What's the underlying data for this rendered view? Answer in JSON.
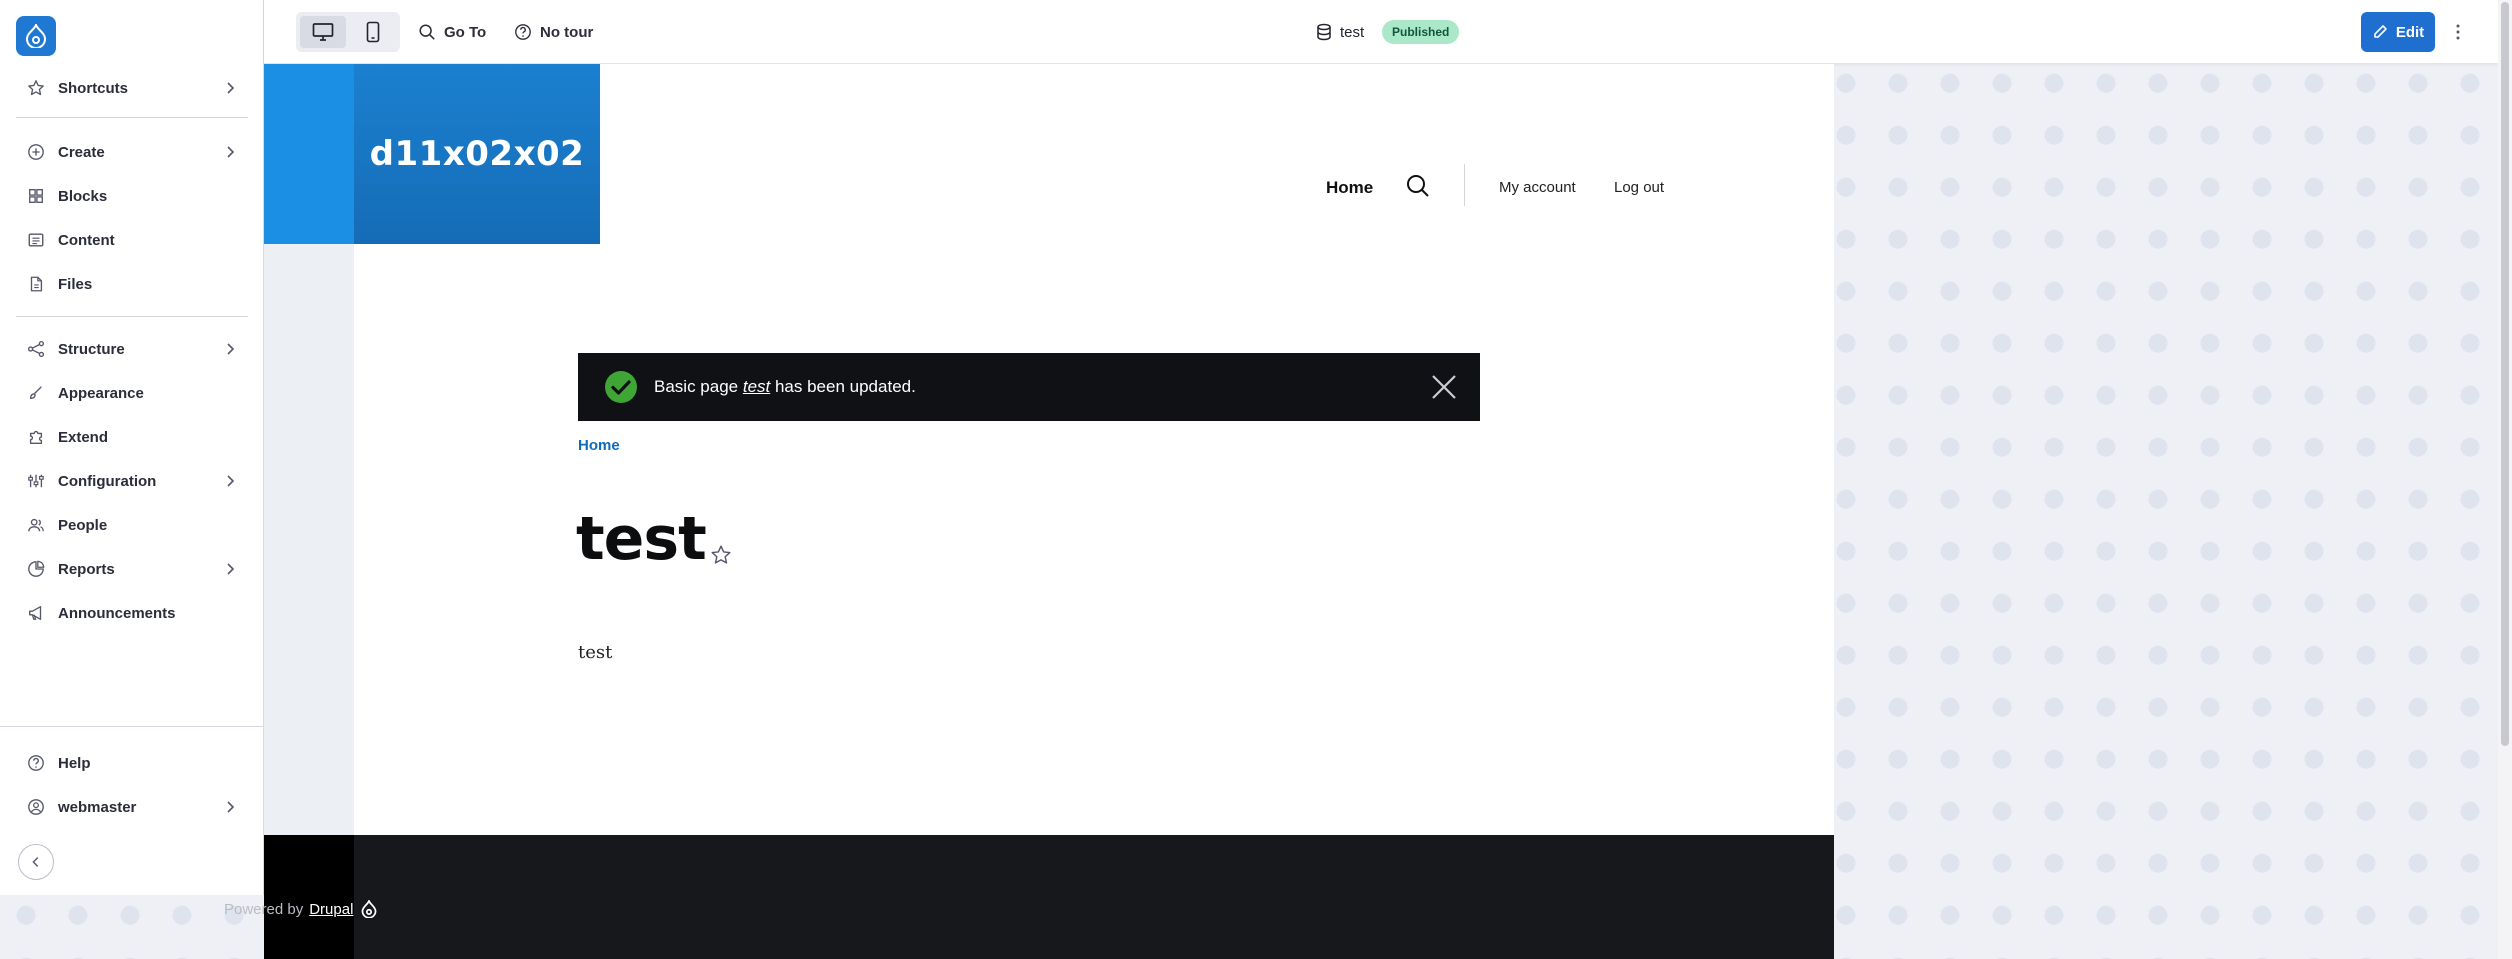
{
  "sidebar": {
    "items": [
      {
        "label": "Shortcuts",
        "icon": "star-icon",
        "has_children": true
      },
      {
        "label": "Create",
        "icon": "plus-circle-icon",
        "has_children": true
      },
      {
        "label": "Blocks",
        "icon": "blocks-icon",
        "has_children": false
      },
      {
        "label": "Content",
        "icon": "content-icon",
        "has_children": false
      },
      {
        "label": "Files",
        "icon": "file-icon",
        "has_children": false
      },
      {
        "label": "Structure",
        "icon": "structure-icon",
        "has_children": true
      },
      {
        "label": "Appearance",
        "icon": "brush-icon",
        "has_children": false
      },
      {
        "label": "Extend",
        "icon": "puzzle-icon",
        "has_children": false
      },
      {
        "label": "Configuration",
        "icon": "sliders-icon",
        "has_children": true
      },
      {
        "label": "People",
        "icon": "people-icon",
        "has_children": false
      },
      {
        "label": "Reports",
        "icon": "reports-icon",
        "has_children": true
      },
      {
        "label": "Announcements",
        "icon": "megaphone-icon",
        "has_children": false
      }
    ],
    "bottom": [
      {
        "label": "Help",
        "icon": "help-icon"
      },
      {
        "label": "webmaster",
        "icon": "user-circle-icon"
      }
    ]
  },
  "topbar": {
    "goto_label": "Go To",
    "tour_label": "No tour",
    "title": "test",
    "status": "Published",
    "edit_label": "Edit"
  },
  "site": {
    "name": "d11x02x02",
    "nav": {
      "home": "Home",
      "account": "My account",
      "logout": "Log out"
    },
    "message": {
      "prefix": "Basic page ",
      "link": "test",
      "suffix": " has been updated."
    },
    "breadcrumb": "Home",
    "page_title": "test",
    "body": "test",
    "footer": {
      "powered_by": "Powered by",
      "link": "Drupal"
    }
  },
  "colors": {
    "accent": "#1f6fd0",
    "brand_blue": "#156cb6",
    "published_bg": "#aae8c9",
    "message_bg": "#0f1115"
  }
}
